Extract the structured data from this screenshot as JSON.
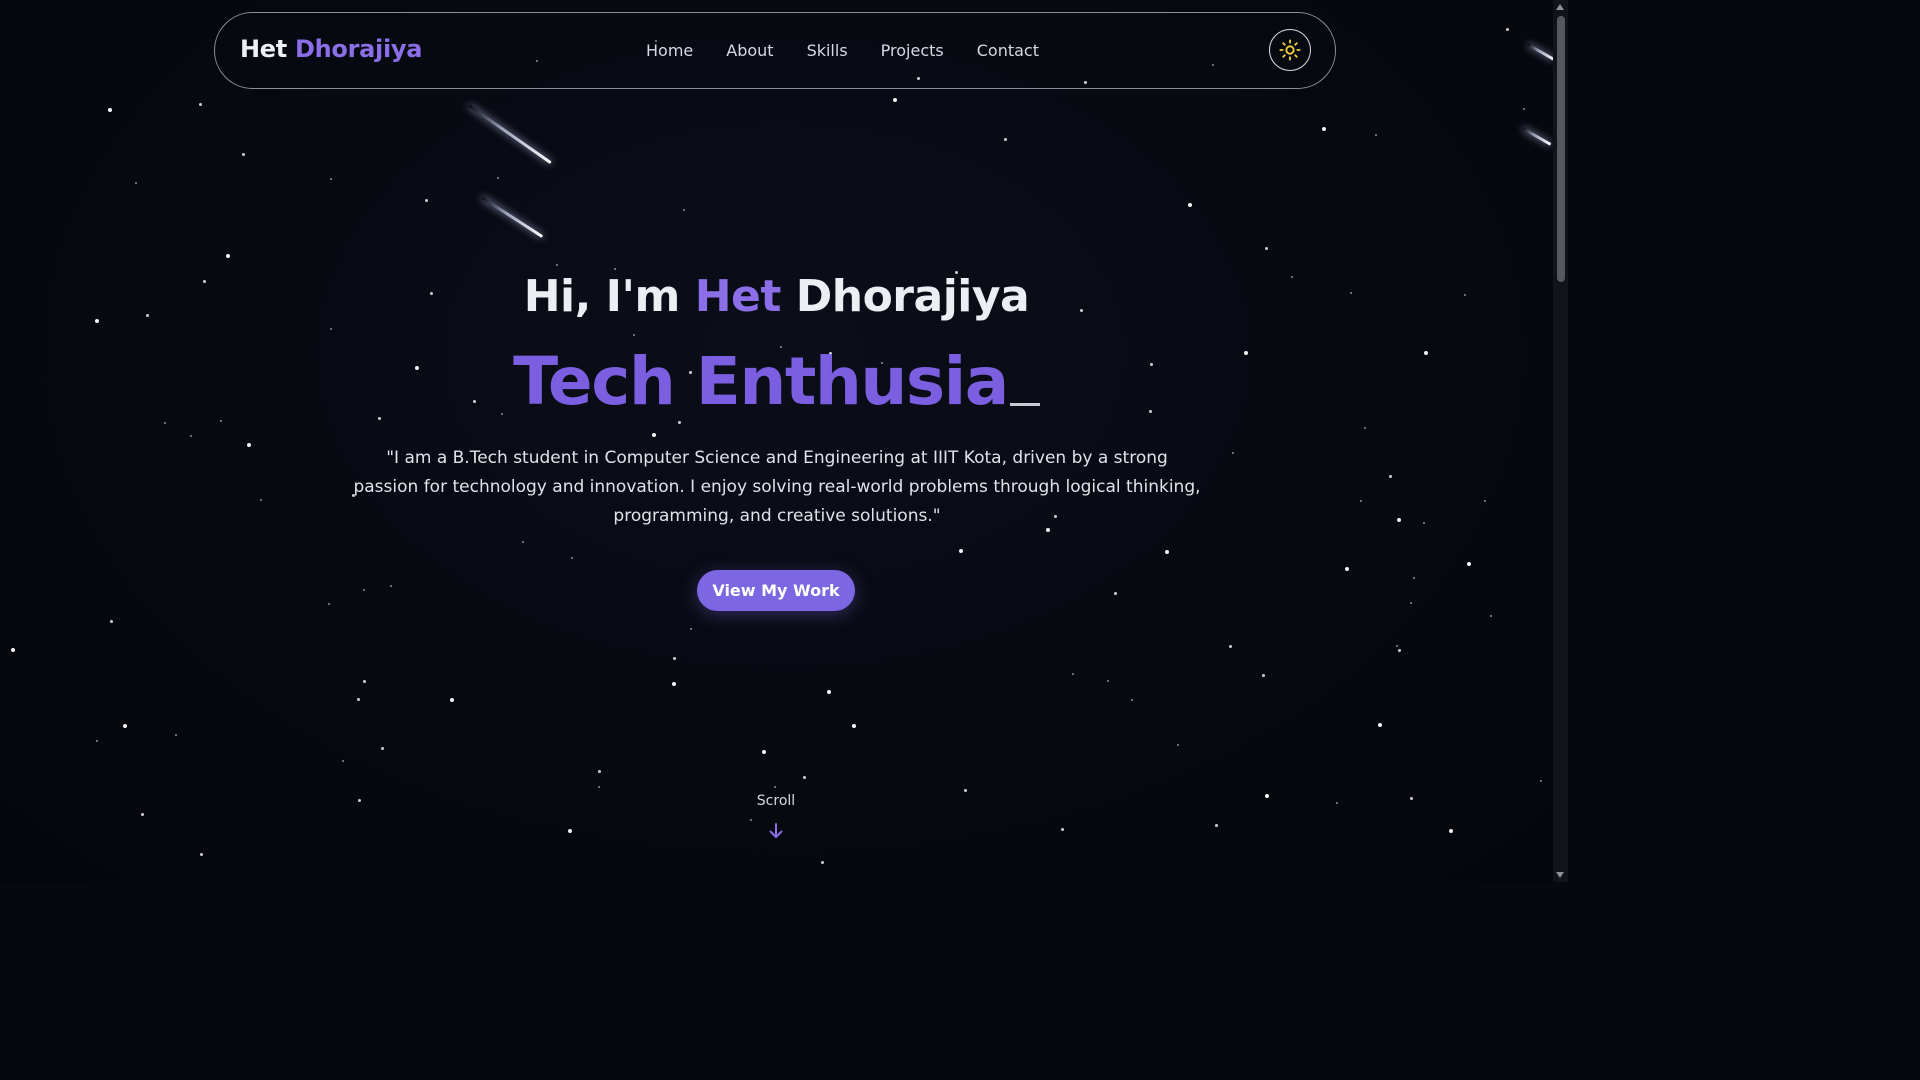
{
  "brand": {
    "first": "Het",
    "last": "Dhorajiya"
  },
  "nav": {
    "links": [
      "Home",
      "About",
      "Skills",
      "Projects",
      "Contact"
    ],
    "theme_icon": "sun-icon"
  },
  "hero": {
    "greeting": "Hi, I'm",
    "first_name": "Het",
    "last_name": "Dhorajiya",
    "role": "Tech Enthusia",
    "bio": "\"I am a B.Tech student in Computer Science and Engineering at IIIT Kota, driven by a strong passion for technology and innovation. I enjoy solving real-world problems through logical thinking, programming, and creative solutions.\"",
    "cta_label": "View My Work"
  },
  "scroll": {
    "label": "Scroll",
    "icon": "arrow-down-icon"
  },
  "colors": {
    "background": "#060810",
    "accent": "#8b6ee8",
    "button": "#7c66e1",
    "text": "#eceef4"
  }
}
